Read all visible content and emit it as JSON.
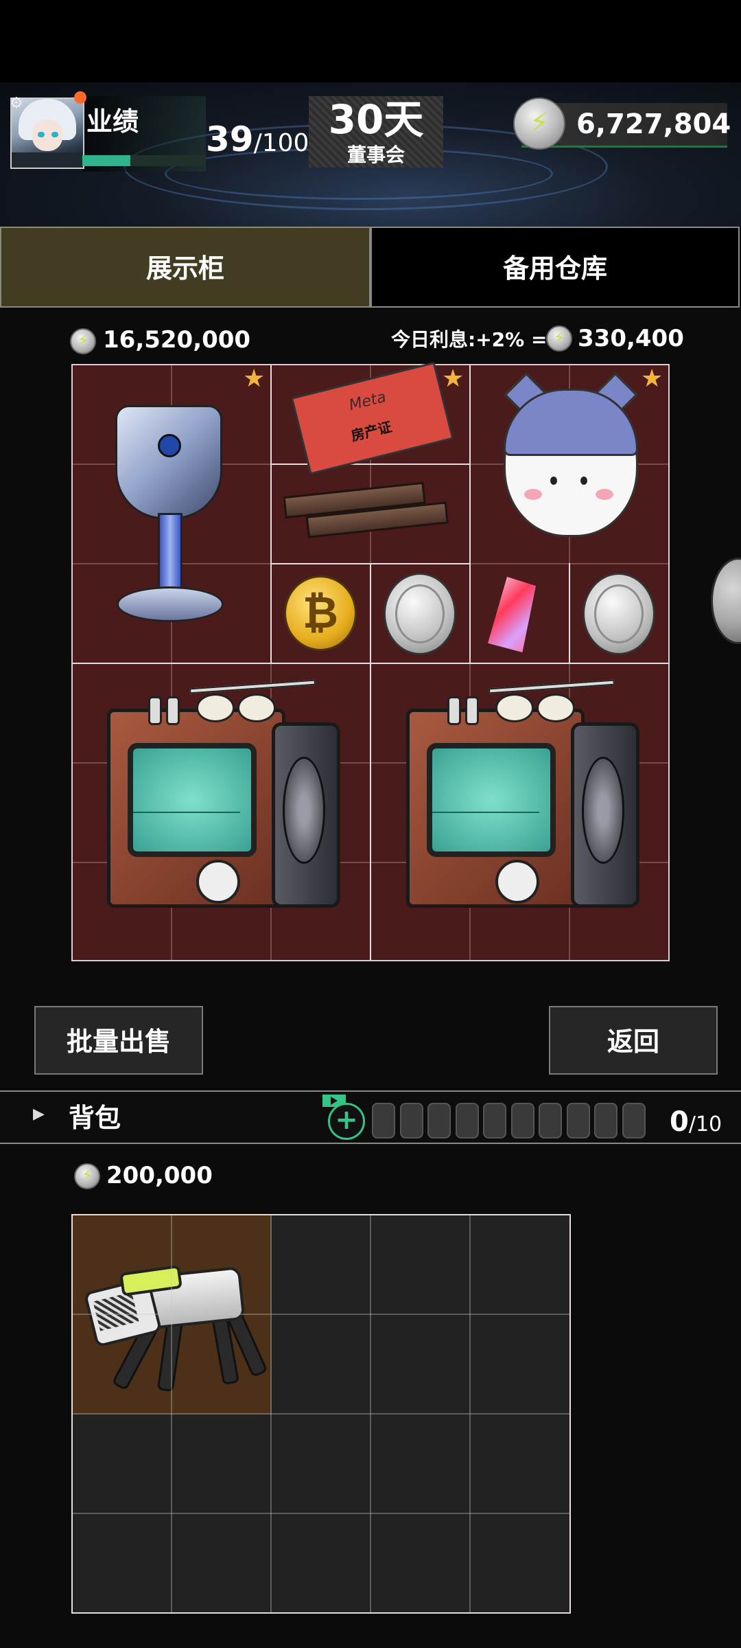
{
  "header": {
    "performance_label": "业绩",
    "performance_current": "39",
    "performance_max": "/100",
    "performance_progress": 0.39,
    "board_days": "30天",
    "board_label": "董事会",
    "balance": "6,727,804"
  },
  "tabs": {
    "showcase": "展示柜",
    "storage": "备用仓库"
  },
  "showcase": {
    "total_value": "16,520,000",
    "interest_label": "今日利息:+2% =",
    "interest_value": "330,400",
    "items": [
      {
        "name": "trophy",
        "starred": true
      },
      {
        "name": "property-deed",
        "label": "Meta",
        "sublabel": "房产证",
        "starred": true
      },
      {
        "name": "contract-sticks"
      },
      {
        "name": "cat-plush",
        "starred": true
      },
      {
        "name": "bitcoin",
        "symbol": "₿"
      },
      {
        "name": "silver-coin"
      },
      {
        "name": "crystal"
      },
      {
        "name": "silver-coin"
      },
      {
        "name": "retro-tv"
      },
      {
        "name": "retro-tv"
      }
    ]
  },
  "buttons": {
    "bulk_sell": "批量出售",
    "return": "返回"
  },
  "backpack": {
    "title": "背包",
    "count_current": "0",
    "count_max": "/10",
    "add_symbol": "+",
    "total_value": "200,000",
    "items": [
      {
        "name": "robot-dog"
      }
    ]
  },
  "icons": {
    "coin": "lightning-coin-icon",
    "gear": "gear-icon",
    "chevron": "triangle-right-icon",
    "star": "star-icon",
    "bolt_glyph": "⚡",
    "star_glyph": "★",
    "gear_glyph": "⚙",
    "chevron_glyph": "▶"
  },
  "colors": {
    "accent_green": "#33c48a",
    "showcase_bg": "#4b1a1a",
    "tab_active": "#423d22",
    "star": "#f2b53c"
  }
}
